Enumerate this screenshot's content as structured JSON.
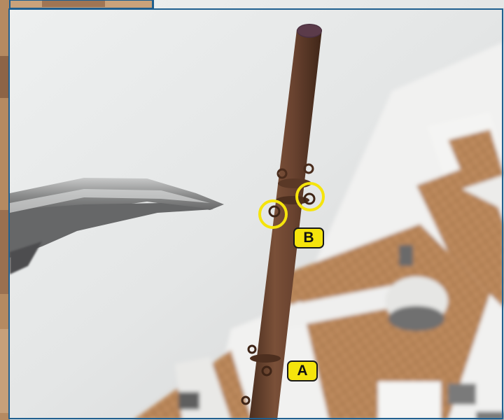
{
  "callouts": {
    "a": "A",
    "b": "B"
  },
  "colors": {
    "callout_fill": "#f5e40c",
    "highlight_ring": "#f5e40c",
    "frame_border": "#1f5f8f",
    "mast": "#6e4630",
    "deck_wood": "#b8865a"
  }
}
